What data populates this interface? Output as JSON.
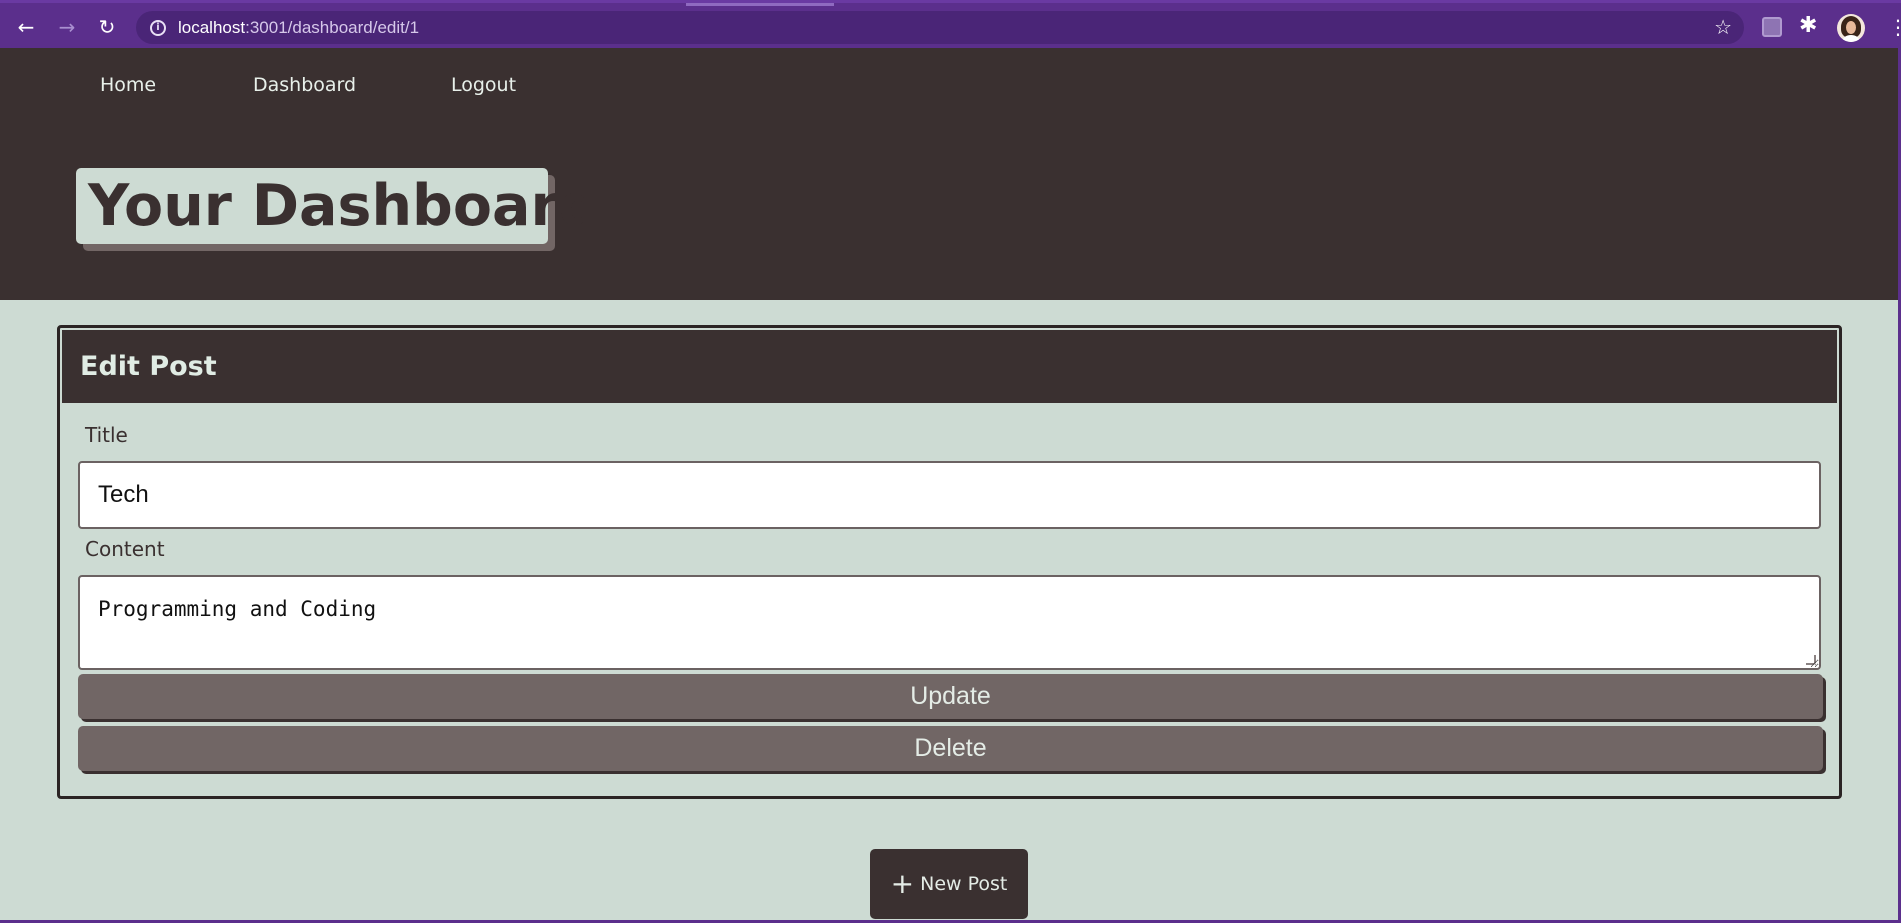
{
  "browser": {
    "back_icon": "←",
    "forward_icon": "→",
    "reload_icon": "↻",
    "url_host": "localhost",
    "url_path": ":3001/dashboard/edit/1",
    "info_icon": "i",
    "star_icon": "☆",
    "puzzle_icon": "✱",
    "menu_icon": "⋮"
  },
  "nav": {
    "items": [
      {
        "label": "Home"
      },
      {
        "label": "Dashboard"
      },
      {
        "label": "Logout"
      }
    ]
  },
  "header": {
    "title": "Your Dashboard"
  },
  "edit_post": {
    "heading": "Edit Post",
    "title_label": "Title",
    "title_value": "Tech",
    "content_label": "Content",
    "content_value": "Programming and Coding",
    "update_label": "Update",
    "delete_label": "Delete"
  },
  "new_post": {
    "icon": "+",
    "label": "New Post"
  },
  "colors": {
    "browser_chrome": "#5b2f8c",
    "header_bg": "#3a3030",
    "page_bg": "#cddbd3",
    "button_bg": "#716665"
  }
}
